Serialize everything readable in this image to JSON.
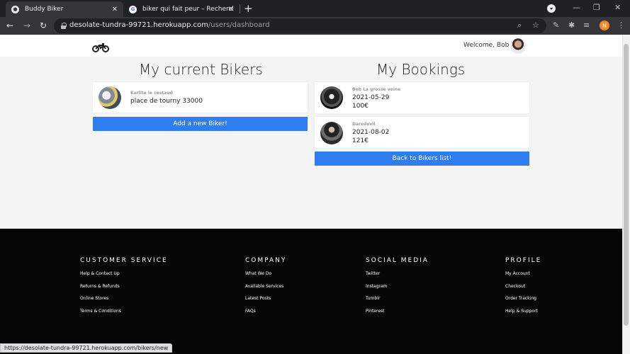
{
  "browser": {
    "tabs": [
      {
        "title": "Buddy Biker",
        "active": true
      },
      {
        "title": "biker qui fait peur – Recherche G",
        "active": false
      }
    ],
    "url_host": "desolate-tundra-99721.herokuapp.com",
    "url_path": "/users/dashboard",
    "profile_initial": "N",
    "status_url": "https://desolate-tundra-99721.herokuapp.com/bikers/new"
  },
  "nav": {
    "welcome": "Welcome, Bob"
  },
  "bikers": {
    "title": "My current Bikers",
    "items": [
      {
        "name": "Karlito le costaud",
        "address": "place de tourny 33000"
      }
    ],
    "add_button": "Add a new Biker!"
  },
  "bookings": {
    "title": "My Bookings",
    "items": [
      {
        "name": "Bob La grosse veine",
        "date": "2021-05-29",
        "price": "100€"
      },
      {
        "name": "Daredevil",
        "date": "2021-08-02",
        "price": "121€"
      }
    ],
    "back_button": "Back to Bikers list!"
  },
  "footer": {
    "customer_service": {
      "title": "CUSTOMER SERVICE",
      "links": [
        "Help & Contact Up",
        "Returns & Refunds",
        "Online Stores",
        "Terms & Conditions"
      ]
    },
    "company": {
      "title": "COMPANY",
      "links": [
        "What We Do",
        "Available Services",
        "Latest Posts",
        "FAQs"
      ]
    },
    "social": {
      "title": "SOCIAL MEDIA",
      "links": [
        "Twitter",
        "Instagram",
        "Tumblr",
        "Pinterest"
      ]
    },
    "profile": {
      "title": "PROFILE",
      "links": [
        "My Account",
        "Checkout",
        "Order Tracking",
        "Help & Support"
      ]
    }
  },
  "colors": {
    "button_blue": "#2f7ef0",
    "footer_bg": "#060606",
    "page_bg": "#f4f4f4"
  }
}
